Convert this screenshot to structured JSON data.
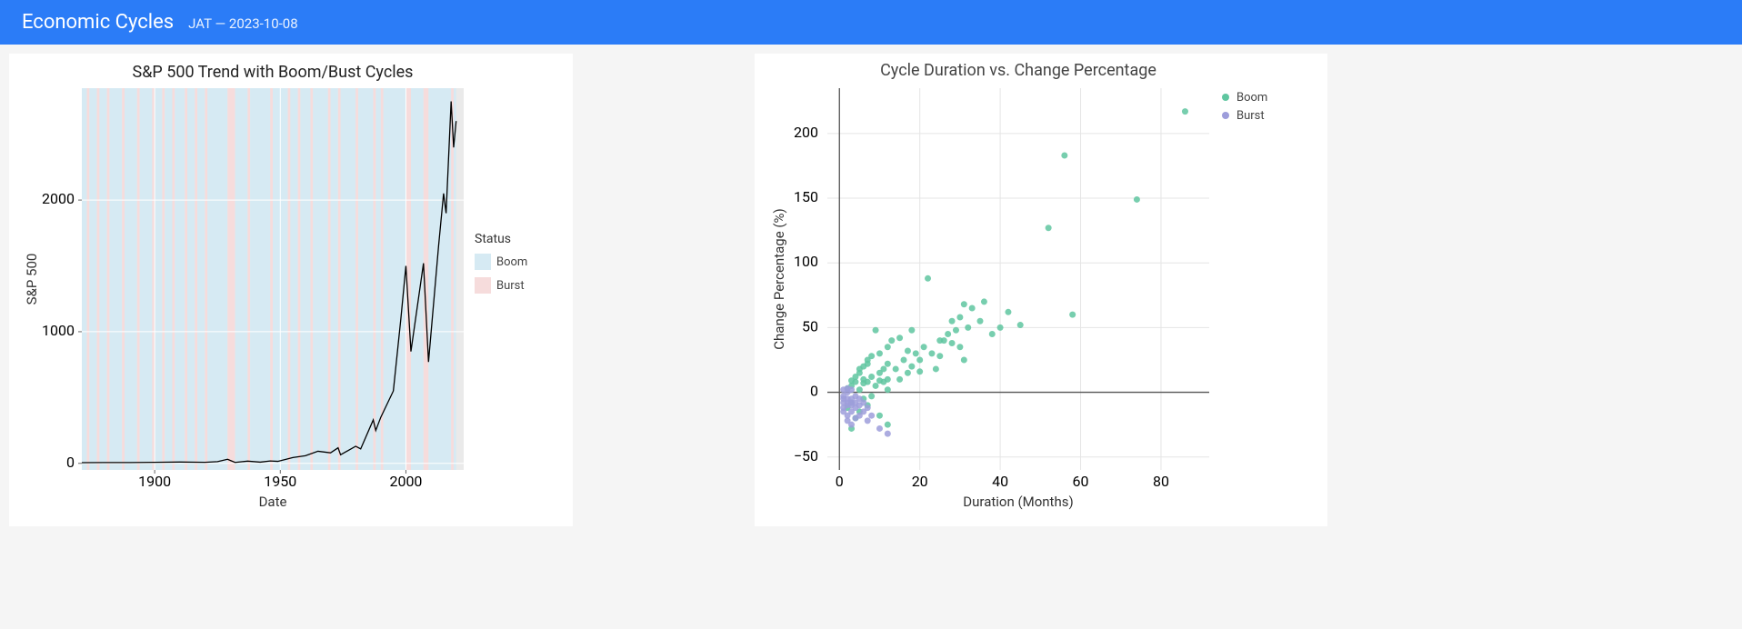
{
  "header": {
    "title": "Economic Cycles",
    "subtitle": "JAT — 2023-10-08"
  },
  "chart_data": [
    {
      "type": "line",
      "title": "S&P 500 Trend with Boom/Bust Cycles",
      "xlabel": "Date",
      "ylabel": "S&P 500",
      "x_ticks": [
        1900,
        1950,
        2000
      ],
      "y_ticks": [
        0,
        1000,
        2000
      ],
      "xlim": [
        1871,
        2023
      ],
      "ylim": [
        -50,
        2850
      ],
      "legend_title": "Status",
      "legend": [
        "Boom",
        "Burst"
      ],
      "legend_colors": [
        "#d6eaf3",
        "#f6dcdc"
      ],
      "line_color": "#000",
      "series": [
        {
          "x": 1871,
          "y": 5
        },
        {
          "x": 1880,
          "y": 6
        },
        {
          "x": 1890,
          "y": 6
        },
        {
          "x": 1900,
          "y": 8
        },
        {
          "x": 1910,
          "y": 10
        },
        {
          "x": 1920,
          "y": 8
        },
        {
          "x": 1925,
          "y": 13
        },
        {
          "x": 1929,
          "y": 31
        },
        {
          "x": 1932,
          "y": 7
        },
        {
          "x": 1937,
          "y": 17
        },
        {
          "x": 1942,
          "y": 9
        },
        {
          "x": 1946,
          "y": 18
        },
        {
          "x": 1949,
          "y": 15
        },
        {
          "x": 1955,
          "y": 44
        },
        {
          "x": 1960,
          "y": 58
        },
        {
          "x": 1965,
          "y": 92
        },
        {
          "x": 1970,
          "y": 80
        },
        {
          "x": 1973,
          "y": 118
        },
        {
          "x": 1974,
          "y": 65
        },
        {
          "x": 1980,
          "y": 130
        },
        {
          "x": 1982,
          "y": 110
        },
        {
          "x": 1987,
          "y": 330
        },
        {
          "x": 1988,
          "y": 250
        },
        {
          "x": 1990,
          "y": 350
        },
        {
          "x": 1995,
          "y": 550
        },
        {
          "x": 1998,
          "y": 1100
        },
        {
          "x": 2000,
          "y": 1500
        },
        {
          "x": 2002,
          "y": 850
        },
        {
          "x": 2007,
          "y": 1520
        },
        {
          "x": 2009,
          "y": 770
        },
        {
          "x": 2013,
          "y": 1650
        },
        {
          "x": 2015,
          "y": 2050
        },
        {
          "x": 2016,
          "y": 1900
        },
        {
          "x": 2018,
          "y": 2750
        },
        {
          "x": 2019,
          "y": 2400
        },
        {
          "x": 2020,
          "y": 2600
        }
      ],
      "bg_bands": [
        {
          "x0": 1871,
          "x1": 1873,
          "kind": "boom"
        },
        {
          "x0": 1873,
          "x1": 1874,
          "kind": "burst"
        },
        {
          "x0": 1874,
          "x1": 1877,
          "kind": "boom"
        },
        {
          "x0": 1877,
          "x1": 1878,
          "kind": "burst"
        },
        {
          "x0": 1878,
          "x1": 1881,
          "kind": "boom"
        },
        {
          "x0": 1881,
          "x1": 1882,
          "kind": "burst"
        },
        {
          "x0": 1882,
          "x1": 1887,
          "kind": "boom"
        },
        {
          "x0": 1887,
          "x1": 1888,
          "kind": "burst"
        },
        {
          "x0": 1888,
          "x1": 1893,
          "kind": "boom"
        },
        {
          "x0": 1893,
          "x1": 1894,
          "kind": "burst"
        },
        {
          "x0": 1894,
          "x1": 1899,
          "kind": "boom"
        },
        {
          "x0": 1899,
          "x1": 1900,
          "kind": "burst"
        },
        {
          "x0": 1900,
          "x1": 1903,
          "kind": "boom"
        },
        {
          "x0": 1903,
          "x1": 1904,
          "kind": "burst"
        },
        {
          "x0": 1904,
          "x1": 1907,
          "kind": "boom"
        },
        {
          "x0": 1907,
          "x1": 1908,
          "kind": "burst"
        },
        {
          "x0": 1908,
          "x1": 1912,
          "kind": "boom"
        },
        {
          "x0": 1912,
          "x1": 1913,
          "kind": "burst"
        },
        {
          "x0": 1913,
          "x1": 1916,
          "kind": "boom"
        },
        {
          "x0": 1916,
          "x1": 1917,
          "kind": "burst"
        },
        {
          "x0": 1917,
          "x1": 1920,
          "kind": "boom"
        },
        {
          "x0": 1920,
          "x1": 1921,
          "kind": "burst"
        },
        {
          "x0": 1921,
          "x1": 1929,
          "kind": "boom"
        },
        {
          "x0": 1929,
          "x1": 1932,
          "kind": "burst"
        },
        {
          "x0": 1932,
          "x1": 1937,
          "kind": "boom"
        },
        {
          "x0": 1937,
          "x1": 1938,
          "kind": "burst"
        },
        {
          "x0": 1938,
          "x1": 1946,
          "kind": "boom"
        },
        {
          "x0": 1946,
          "x1": 1947,
          "kind": "burst"
        },
        {
          "x0": 1947,
          "x1": 1953,
          "kind": "boom"
        },
        {
          "x0": 1953,
          "x1": 1954,
          "kind": "burst"
        },
        {
          "x0": 1954,
          "x1": 1957,
          "kind": "boom"
        },
        {
          "x0": 1957,
          "x1": 1958,
          "kind": "burst"
        },
        {
          "x0": 1958,
          "x1": 1962,
          "kind": "boom"
        },
        {
          "x0": 1962,
          "x1": 1963,
          "kind": "burst"
        },
        {
          "x0": 1963,
          "x1": 1969,
          "kind": "boom"
        },
        {
          "x0": 1969,
          "x1": 1970,
          "kind": "burst"
        },
        {
          "x0": 1970,
          "x1": 1973,
          "kind": "boom"
        },
        {
          "x0": 1973,
          "x1": 1974,
          "kind": "burst"
        },
        {
          "x0": 1974,
          "x1": 1980,
          "kind": "boom"
        },
        {
          "x0": 1980,
          "x1": 1981,
          "kind": "burst"
        },
        {
          "x0": 1981,
          "x1": 1987,
          "kind": "boom"
        },
        {
          "x0": 1987,
          "x1": 1988,
          "kind": "burst"
        },
        {
          "x0": 1988,
          "x1": 1990,
          "kind": "boom"
        },
        {
          "x0": 1990,
          "x1": 1991,
          "kind": "burst"
        },
        {
          "x0": 1991,
          "x1": 2000,
          "kind": "boom"
        },
        {
          "x0": 2000,
          "x1": 2002,
          "kind": "burst"
        },
        {
          "x0": 2002,
          "x1": 2007,
          "kind": "boom"
        },
        {
          "x0": 2007,
          "x1": 2009,
          "kind": "burst"
        },
        {
          "x0": 2009,
          "x1": 2018,
          "kind": "boom"
        },
        {
          "x0": 2018,
          "x1": 2019,
          "kind": "burst"
        },
        {
          "x0": 2019,
          "x1": 2020,
          "kind": "boom"
        }
      ]
    },
    {
      "type": "scatter",
      "title": "Cycle Duration vs. Change Percentage",
      "xlabel": "Duration (Months)",
      "ylabel": "Change Percentage (%)",
      "x_ticks": [
        0,
        20,
        40,
        60,
        80
      ],
      "y_ticks": [
        -50,
        0,
        50,
        100,
        150,
        200
      ],
      "xlim": [
        -3,
        92
      ],
      "ylim": [
        -60,
        235
      ],
      "legend": [
        "Boom",
        "Burst"
      ],
      "legend_colors": [
        "#5fc6a0",
        "#9d9ddb"
      ],
      "series": [
        {
          "name": "Boom",
          "color": "#5fc6a0",
          "points": [
            [
              2,
              -12
            ],
            [
              2,
              3
            ],
            [
              3,
              -8
            ],
            [
              3,
              5
            ],
            [
              3,
              9
            ],
            [
              3,
              -28
            ],
            [
              4,
              -20
            ],
            [
              4,
              8
            ],
            [
              4,
              12
            ],
            [
              5,
              -15
            ],
            [
              5,
              2
            ],
            [
              5,
              15
            ],
            [
              5,
              18
            ],
            [
              6,
              -5
            ],
            [
              6,
              7
            ],
            [
              6,
              10
            ],
            [
              6,
              20
            ],
            [
              7,
              -10
            ],
            [
              7,
              8
            ],
            [
              7,
              22
            ],
            [
              7,
              25
            ],
            [
              8,
              -3
            ],
            [
              8,
              12
            ],
            [
              8,
              28
            ],
            [
              9,
              5
            ],
            [
              9,
              48
            ],
            [
              10,
              -18
            ],
            [
              10,
              9
            ],
            [
              10,
              15
            ],
            [
              10,
              30
            ],
            [
              11,
              8
            ],
            [
              11,
              18
            ],
            [
              12,
              -25
            ],
            [
              12,
              2
            ],
            [
              12,
              10
            ],
            [
              12,
              22
            ],
            [
              12,
              35
            ],
            [
              13,
              40
            ],
            [
              14,
              18
            ],
            [
              15,
              10
            ],
            [
              15,
              42
            ],
            [
              16,
              25
            ],
            [
              17,
              15
            ],
            [
              17,
              32
            ],
            [
              18,
              20
            ],
            [
              18,
              48
            ],
            [
              19,
              30
            ],
            [
              20,
              16
            ],
            [
              20,
              25
            ],
            [
              21,
              35
            ],
            [
              22,
              88
            ],
            [
              23,
              30
            ],
            [
              24,
              18
            ],
            [
              25,
              28
            ],
            [
              25,
              40
            ],
            [
              26,
              40
            ],
            [
              27,
              45
            ],
            [
              28,
              38
            ],
            [
              28,
              55
            ],
            [
              29,
              48
            ],
            [
              30,
              35
            ],
            [
              30,
              58
            ],
            [
              31,
              25
            ],
            [
              31,
              68
            ],
            [
              32,
              50
            ],
            [
              33,
              65
            ],
            [
              35,
              55
            ],
            [
              36,
              70
            ],
            [
              38,
              45
            ],
            [
              40,
              50
            ],
            [
              42,
              62
            ],
            [
              45,
              52
            ],
            [
              52,
              127
            ],
            [
              56,
              183
            ],
            [
              58,
              60
            ],
            [
              74,
              149
            ],
            [
              86,
              217
            ]
          ]
        },
        {
          "name": "Burst",
          "color": "#9d9ddb",
          "points": [
            [
              1,
              -5
            ],
            [
              1,
              -8
            ],
            [
              1,
              -3
            ],
            [
              1,
              -12
            ],
            [
              1,
              2
            ],
            [
              1,
              -15
            ],
            [
              2,
              -18
            ],
            [
              2,
              -10
            ],
            [
              2,
              -8
            ],
            [
              2,
              -5
            ],
            [
              2,
              -22
            ],
            [
              2,
              0
            ],
            [
              2,
              3
            ],
            [
              3,
              -25
            ],
            [
              3,
              -15
            ],
            [
              3,
              -10
            ],
            [
              3,
              -8
            ],
            [
              3,
              -5
            ],
            [
              3,
              2
            ],
            [
              4,
              -12
            ],
            [
              4,
              -20
            ],
            [
              4,
              -8
            ],
            [
              4,
              -3
            ],
            [
              5,
              -18
            ],
            [
              5,
              -10
            ],
            [
              5,
              -5
            ],
            [
              6,
              -15
            ],
            [
              6,
              -8
            ],
            [
              7,
              -22
            ],
            [
              7,
              -12
            ],
            [
              8,
              -18
            ],
            [
              10,
              -28
            ],
            [
              12,
              -32
            ]
          ]
        }
      ]
    }
  ]
}
